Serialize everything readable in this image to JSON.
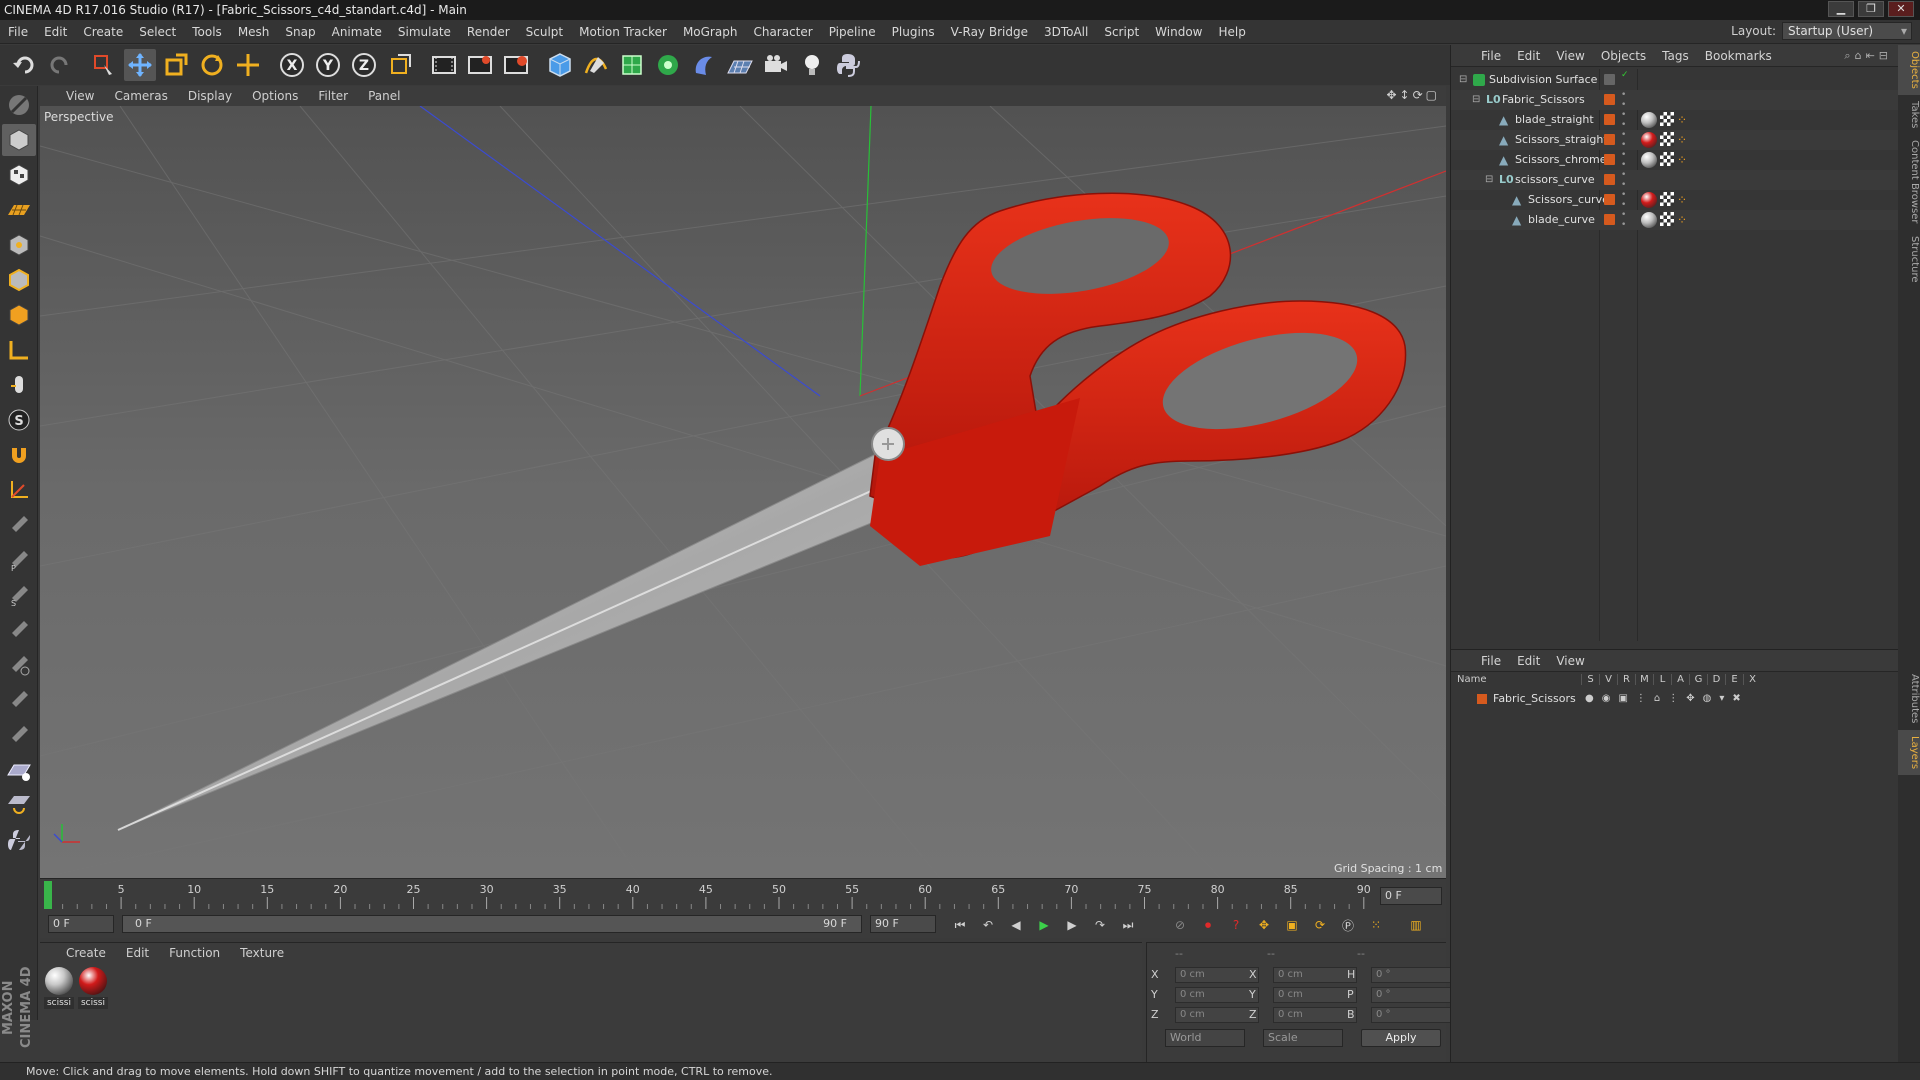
{
  "window": {
    "title": "CINEMA 4D R17.016 Studio (R17) - [Fabric_Scissors_c4d_standart.c4d] - Main"
  },
  "menubar": {
    "items": [
      "File",
      "Edit",
      "Create",
      "Select",
      "Tools",
      "Mesh",
      "Snap",
      "Animate",
      "Simulate",
      "Render",
      "Sculpt",
      "Motion Tracker",
      "MoGraph",
      "Character",
      "Pipeline",
      "Plugins",
      "V-Ray Bridge",
      "3DToAll",
      "Script",
      "Window",
      "Help"
    ],
    "layout_label": "Layout:",
    "layout_value": "Startup (User)"
  },
  "toolbar": {
    "icons": [
      "undo-icon",
      "redo-icon",
      "live-selection-icon",
      "move-icon",
      "scale-icon",
      "rotate-icon",
      "last-tool-icon",
      "x-axis-icon",
      "y-axis-icon",
      "z-axis-icon",
      "coordinate-system-icon",
      "render-view-icon",
      "render-picture-viewer-icon",
      "edit-render-settings-icon",
      "cube-icon",
      "pen-spline-icon",
      "subdivision-icon",
      "cloner-icon",
      "deformer-icon",
      "floor-icon",
      "camera-icon",
      "light-icon",
      "python-icon"
    ]
  },
  "viewport": {
    "menu": [
      "View",
      "Cameras",
      "Display",
      "Options",
      "Filter",
      "Panel"
    ],
    "label": "Perspective",
    "grid_spacing": "Grid Spacing : 1 cm"
  },
  "timeline": {
    "ticks": [
      "0",
      "5",
      "10",
      "15",
      "20",
      "25",
      "30",
      "35",
      "40",
      "45",
      "50",
      "55",
      "60",
      "65",
      "70",
      "75",
      "80",
      "85",
      "90"
    ],
    "current_frame": "0 F",
    "start_field": "0 F",
    "range_start": "0 F",
    "range_end": "90 F",
    "end_field": "90 F"
  },
  "materials": {
    "menu": [
      "Create",
      "Edit",
      "Function",
      "Texture"
    ],
    "items": [
      {
        "label": "scissi",
        "color": "#c8c8c8"
      },
      {
        "label": "scissi",
        "color": "#d11a1a"
      }
    ]
  },
  "coordinates": {
    "headers": [
      "--",
      "--",
      "--"
    ],
    "rows": [
      {
        "a": "X",
        "av": "0 cm",
        "b": "X",
        "bv": "0 cm",
        "c": "H",
        "cv": "0 °"
      },
      {
        "a": "Y",
        "av": "0 cm",
        "b": "Y",
        "bv": "0 cm",
        "c": "P",
        "cv": "0 °"
      },
      {
        "a": "Z",
        "av": "0 cm",
        "b": "Z",
        "bv": "0 cm",
        "c": "B",
        "cv": "0 °"
      }
    ],
    "world": "World",
    "scale": "Scale",
    "apply": "Apply"
  },
  "objects": {
    "menu": [
      "File",
      "Edit",
      "View",
      "Objects",
      "Tags",
      "Bookmarks"
    ],
    "tree": [
      {
        "name": "Subdivision Surface",
        "indent": 0,
        "icon": "subdivision-icon",
        "tags": []
      },
      {
        "name": "Fabric_Scissors",
        "indent": 1,
        "icon": "null-icon",
        "tags": []
      },
      {
        "name": "blade_straight",
        "indent": 2,
        "icon": "polygon-icon",
        "tags": [
          "#c0c0c0"
        ]
      },
      {
        "name": "Scissors_straight",
        "indent": 2,
        "icon": "polygon-icon",
        "tags": [
          "#d11a1a"
        ]
      },
      {
        "name": "Scissors_chrome",
        "indent": 2,
        "icon": "polygon-icon",
        "tags": [
          "#c0c0c0"
        ]
      },
      {
        "name": "scissors_curve",
        "indent": 2,
        "icon": "null-icon",
        "tags": []
      },
      {
        "name": "Scissors_curve",
        "indent": 3,
        "icon": "polygon-icon",
        "tags": [
          "#d11a1a"
        ]
      },
      {
        "name": "blade_curve",
        "indent": 3,
        "icon": "polygon-icon",
        "tags": [
          "#c0c0c0"
        ]
      }
    ]
  },
  "layers": {
    "menu": [
      "File",
      "Edit",
      "View"
    ],
    "header_name": "Name",
    "header_cols": [
      "S",
      "V",
      "R",
      "M",
      "L",
      "A",
      "G",
      "D",
      "E",
      "X"
    ],
    "rows": [
      {
        "name": "Fabric_Scissors"
      }
    ]
  },
  "sidetabs": [
    "Objects",
    "Takes",
    "Content Browser",
    "Structure",
    "Attributes",
    "Layers"
  ],
  "status": {
    "text": "Move: Click and drag to move elements. Hold down SHIFT to quantize movement / add to the selection in point mode, CTRL to remove."
  },
  "colors": {
    "accent": "#d65a1e",
    "scissor_red": "#d11a1a"
  }
}
